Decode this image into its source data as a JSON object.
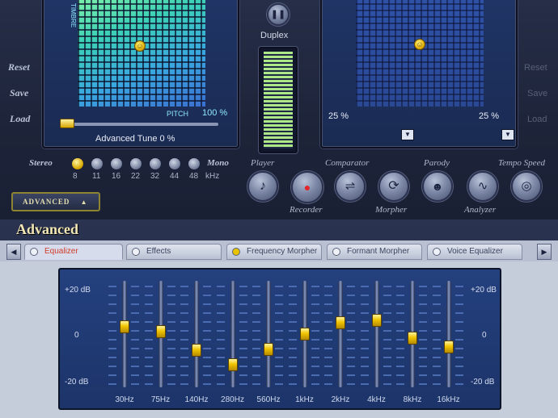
{
  "sidebar": {
    "reset": "Reset",
    "save": "Save",
    "load": "Load"
  },
  "right_labels": {
    "reset": "Reset",
    "save": "Save",
    "load": "Load"
  },
  "pad_left": {
    "axis_label": "TIMBRE",
    "pitch_label": "PITCH",
    "pitch_value": "100 %",
    "caption": "Advanced Tune 0 %",
    "knob_glyph": "☺"
  },
  "pad_right": {
    "left_value": "25 %",
    "right_value": "25 %",
    "knob_glyph": "☺"
  },
  "duplex": {
    "label": "Duplex"
  },
  "stereo_row": {
    "stereo_label": "Stereo",
    "mono_label": "Mono",
    "unit": "kHz",
    "rates": [
      "8",
      "11",
      "16",
      "22",
      "32",
      "44",
      "48"
    ],
    "selected_index": 0
  },
  "advanced_button": {
    "label": "ADVANCED",
    "arrow": "▲"
  },
  "toolbar": {
    "player": "Player",
    "recorder": "Recorder",
    "comparator": "Comparator",
    "morpher": "Morpher",
    "parody": "Parody",
    "analyzer": "Analyzer",
    "tempo": "Tempo Speed"
  },
  "section": {
    "title": "Advanced"
  },
  "tabs": [
    {
      "label": "Equalizer",
      "active": true
    },
    {
      "label": "Effects",
      "active": false
    },
    {
      "label": "Frequency Morpher",
      "active": false
    },
    {
      "label": "Formant Morpher",
      "active": false
    },
    {
      "label": "Voice Equalizer",
      "active": false
    }
  ],
  "equalizer": {
    "db_top": "+20 dB",
    "db_mid": "0",
    "db_bottom": "-20 dB",
    "bands": [
      {
        "label": "30Hz",
        "level": 0.58
      },
      {
        "label": "75Hz",
        "level": 0.53
      },
      {
        "label": "140Hz",
        "level": 0.33
      },
      {
        "label": "280Hz",
        "level": 0.17
      },
      {
        "label": "560Hz",
        "level": 0.34
      },
      {
        "label": "1kHz",
        "level": 0.5
      },
      {
        "label": "2kHz",
        "level": 0.62
      },
      {
        "label": "4kHz",
        "level": 0.65
      },
      {
        "label": "8kHz",
        "level": 0.46
      },
      {
        "label": "16kHz",
        "level": 0.36
      }
    ]
  },
  "colors": {
    "accent": "#e8c400",
    "panel": "#1c3469",
    "active_tab_text": "#d23b2a"
  }
}
